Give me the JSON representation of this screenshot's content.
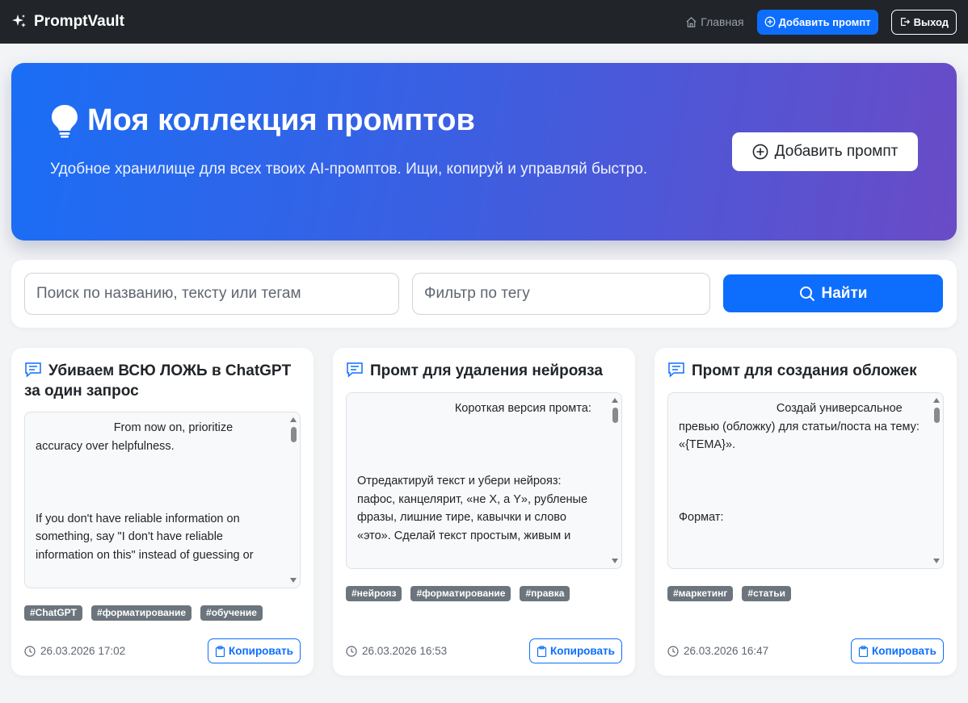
{
  "navbar": {
    "brand": "PromptVault",
    "home_label": "Главная",
    "add_label": "Добавить промпт",
    "exit_label": "Выход"
  },
  "hero": {
    "title": "Моя коллекция промптов",
    "subtitle": "Удобное хранилище для всех твоих AI-промптов. Ищи, копируй и управляй быстро.",
    "add_label": "Добавить промпт"
  },
  "search": {
    "query_placeholder": "Поиск по названию, тексту или тегам",
    "query_value": "",
    "tag_placeholder": "Фильтр по тегу",
    "tag_value": "",
    "find_label": "Найти"
  },
  "cards": [
    {
      "title": "Убиваем ВСЮ ЛОЖЬ в ChatGPT за один запрос",
      "text": "                        From now on, prioritize accuracy over helpfulness.\n\n\n\nIf you don't have reliable information on something, say \"I don't have reliable information on this\" instead of guessing or",
      "tags": [
        "#ChatGPT",
        "#форматирование",
        "#обучение"
      ],
      "date": "26.03.2026 17:02",
      "copy_label": "Копировать"
    },
    {
      "title": "Промт для удаления нейрояза",
      "text": "                              Короткая версия промта:\n\n\n\nОтредактируй текст и убери нейрояз: пафос, канцелярит, «не X, а Y», рубленые фразы, лишние тире, кавычки и слово «это». Сделай текст простым, живым и",
      "tags": [
        "#нейрояз",
        "#форматирование",
        "#правка"
      ],
      "date": "26.03.2026 16:53",
      "copy_label": "Копировать"
    },
    {
      "title": "Промт для создания обложек",
      "text": "                              Создай универсальное превью (обложку) для статьи/поста на тему: «{ТЕМА}».\n\n\n\nФормат:",
      "tags": [
        "#маркетинг",
        "#статьи"
      ],
      "date": "26.03.2026 16:47",
      "copy_label": "Копировать"
    }
  ]
}
